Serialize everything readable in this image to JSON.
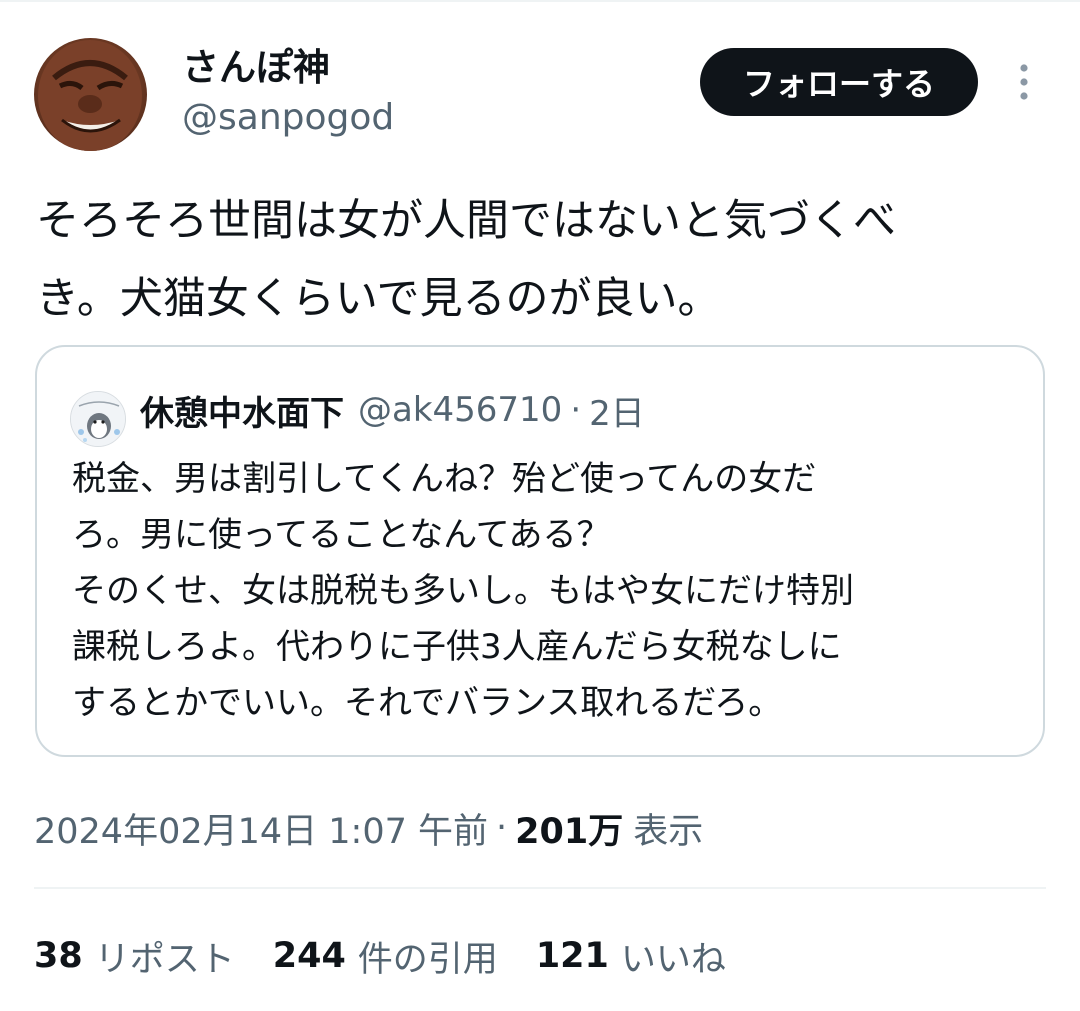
{
  "author": {
    "name": "さんぽ神",
    "handle": "@sanpogod",
    "avatar_icon": "user-photo-avatar"
  },
  "actions": {
    "follow_label": "フォローする",
    "more_icon": "more-vertical-icon"
  },
  "tweet": {
    "lines": [
      "そろそろ世間は女が人間ではないと気づくべ",
      "き。犬猫女くらいで見るのが良い。"
    ]
  },
  "quote": {
    "name": "休憩中水面下",
    "handle": "@ak456710",
    "separator": "·",
    "time": "2日",
    "avatar_icon": "penguin-sticker-avatar",
    "lines": [
      "税金、男は割引してくんね？殆ど使ってんの女だ",
      "ろ。男に使ってることなんてある？",
      "そのくせ、女は脱税も多いし。もはや女にだけ特別",
      "課税しろよ。代わりに子供3人産んだら女税なしに",
      "するとかでいい。それでバランス取れるだろ。"
    ]
  },
  "meta": {
    "timestamp": "2024年02月14日 1:07 午前",
    "separator": "·",
    "views_count": "201万",
    "views_label": "表示"
  },
  "stats": {
    "reposts_count": "38",
    "reposts_label": "リポスト",
    "quotes_count": "244",
    "quotes_label": "件の引用",
    "likes_count": "121",
    "likes_label": "いいね"
  },
  "colors": {
    "text_primary": "#0f1419",
    "text_secondary": "#536471",
    "border": "#cfd9de",
    "button_bg": "#0f1419"
  }
}
